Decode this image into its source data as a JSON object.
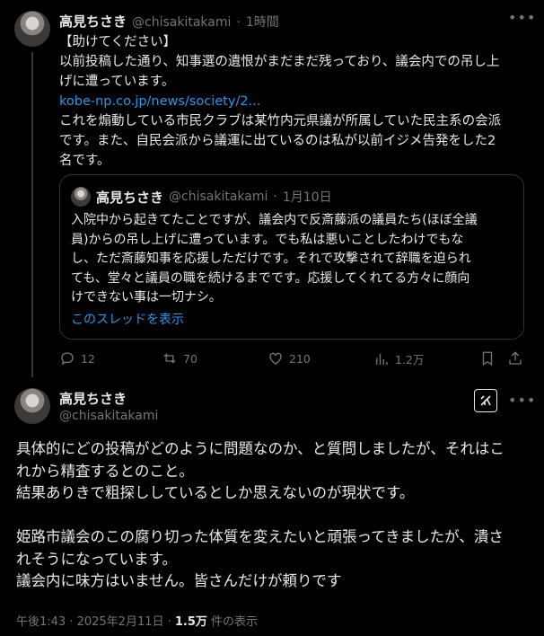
{
  "tweet1": {
    "name": "高見ちさき",
    "handle": "@chisakitakami",
    "time": "1時間",
    "body_line1": "【助けてください】",
    "body_line2": "以前投稿した通り、知事選の遺恨がまだまだ残っており、議会内での吊し上",
    "body_line3": "げに遭っています。",
    "link": "kobe-np.co.jp/news/society/2...",
    "body_line4": "これを煽動している市民クラブは某竹内元県議が所属していた民主系の会派",
    "body_line5": "です。また、自民会派から議運に出ているのは私が以前イジメ告発をした2",
    "body_line6": "名です。",
    "quote": {
      "name": "高見ちさき",
      "handle": "@chisakitakami",
      "date": "1月10日",
      "line1": "入院中から起きてたことですが、議会内で反斎藤派の議員たち(ほぼ全議",
      "line2": "員)からの吊し上げに遭っています。でも私は悪いことしたわけでもな",
      "line3": "し、ただ斎藤知事を応援しただけです。それで攻撃されて辞職を迫られ",
      "line4": "ても、堂々と議員の職を続けるまでです。応援してくれてる方々に顔向",
      "line5": "けできない事は一切ナシ。",
      "show_thread": "このスレッドを表示"
    },
    "actions": {
      "replies": "12",
      "reposts": "70",
      "likes": "210",
      "views": "1.2万"
    }
  },
  "tweet2": {
    "name": "高見ちさき",
    "handle": "@chisakitakami",
    "line1": "具体的にどの投稿がどのように問題なのか、と質問しましたが、それはこ",
    "line2": "れから精査するとのこと。",
    "line3": "結果ありきで粗探ししているとしか思えないのが現状です。",
    "line4": "姫路市議会のこの腐り切った体質を変えたいと頑張ってきましたが、潰さ",
    "line5": "れそうになっています。",
    "line6": "議会内に味方はいません。皆さんだけが頼りです",
    "timestamp": "午後1:43 · 2025年2月11日 · ",
    "views_count": "1.5万",
    "views_label": " 件の表示"
  },
  "icons": {
    "more": "more-horizontal-icon",
    "reply": "reply-icon",
    "repost": "repost-icon",
    "like": "heart-icon",
    "views": "analytics-icon",
    "bookmark": "bookmark-icon",
    "share": "share-icon",
    "grok": "grok-icon"
  },
  "colors": {
    "background": "#000000",
    "text": "#e7e9ea",
    "secondary": "#71767b",
    "link": "#1d9bf0",
    "border": "#2f3336"
  }
}
